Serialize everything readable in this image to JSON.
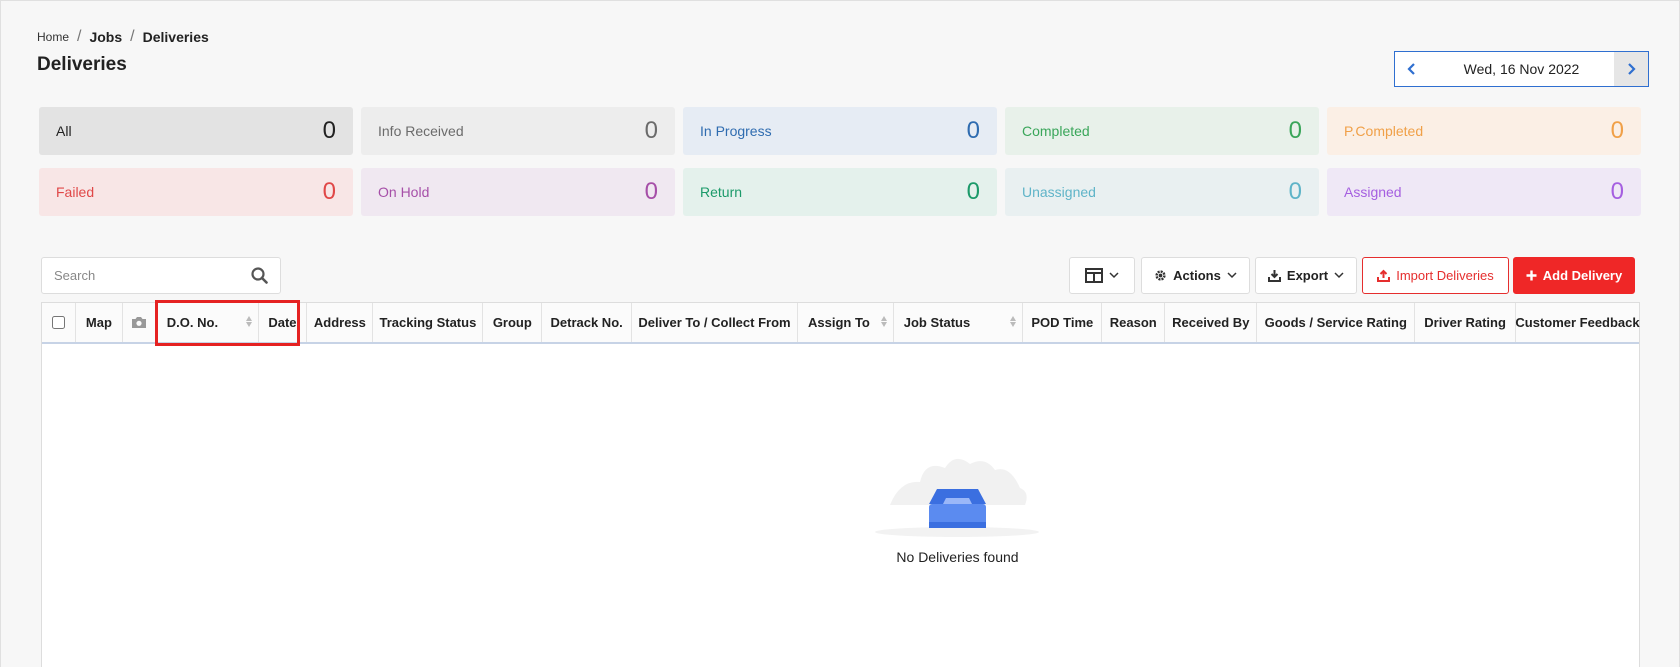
{
  "breadcrumb": {
    "home": "Home",
    "jobs": "Jobs",
    "current": "Deliveries",
    "sep": "/"
  },
  "page_title": "Deliveries",
  "date_nav": {
    "date": "Wed, 16 Nov 2022"
  },
  "stats": [
    {
      "key": "all",
      "label": "All",
      "count": "0",
      "bg": "#e3e3e3",
      "color": "#222222"
    },
    {
      "key": "info-received",
      "label": "Info Received",
      "count": "0",
      "bg": "#ededed",
      "color": "#6b6b6b"
    },
    {
      "key": "in-progress",
      "label": "In Progress",
      "count": "0",
      "bg": "#e6ecf4",
      "color": "#2f6cb0"
    },
    {
      "key": "completed",
      "label": "Completed",
      "count": "0",
      "bg": "#e8f1ea",
      "color": "#3aa65a"
    },
    {
      "key": "p-completed",
      "label": "P.Completed",
      "count": "0",
      "bg": "#fbefe5",
      "color": "#f0a048"
    },
    {
      "key": "failed",
      "label": "Failed",
      "count": "0",
      "bg": "#f8e6e6",
      "color": "#e04848"
    },
    {
      "key": "on-hold",
      "label": "On Hold",
      "count": "0",
      "bg": "#f0e8f1",
      "color": "#a64fa8"
    },
    {
      "key": "return",
      "label": "Return",
      "count": "0",
      "bg": "#e4f1ec",
      "color": "#1c9a6a"
    },
    {
      "key": "unassigned",
      "label": "Unassigned",
      "count": "0",
      "bg": "#e9f0f1",
      "color": "#5fb4c8"
    },
    {
      "key": "assigned",
      "label": "Assigned",
      "count": "0",
      "bg": "#efe8f6",
      "color": "#a55fe0"
    }
  ],
  "search": {
    "placeholder": "Search"
  },
  "toolbar": {
    "actions_label": "Actions",
    "export_label": "Export",
    "import_label": "Import Deliveries",
    "add_label": "Add Delivery"
  },
  "table": {
    "columns": [
      "Map",
      "D.O. No.",
      "Date",
      "Address",
      "Tracking Status",
      "Group",
      "Detrack No.",
      "Deliver To / Collect From",
      "Assign To",
      "Job Status",
      "POD Time",
      "Reason",
      "Received By",
      "Goods / Service Rating",
      "Driver Rating",
      "Customer Feedback"
    ],
    "empty_message": "No Deliveries found"
  },
  "colors": {
    "accent": "#2f6fd0",
    "danger": "#ef2727",
    "highlight": "#e52222",
    "empty_box": "#3b6fe0"
  },
  "icons": {
    "prev": "chevron-left-icon",
    "next": "chevron-right-icon",
    "search": "search-icon",
    "columns": "columns-icon",
    "actions": "gear-icon",
    "export": "download-icon",
    "import": "upload-icon",
    "add": "plus-icon",
    "photo": "camera-icon",
    "empty": "empty-inbox-icon"
  }
}
